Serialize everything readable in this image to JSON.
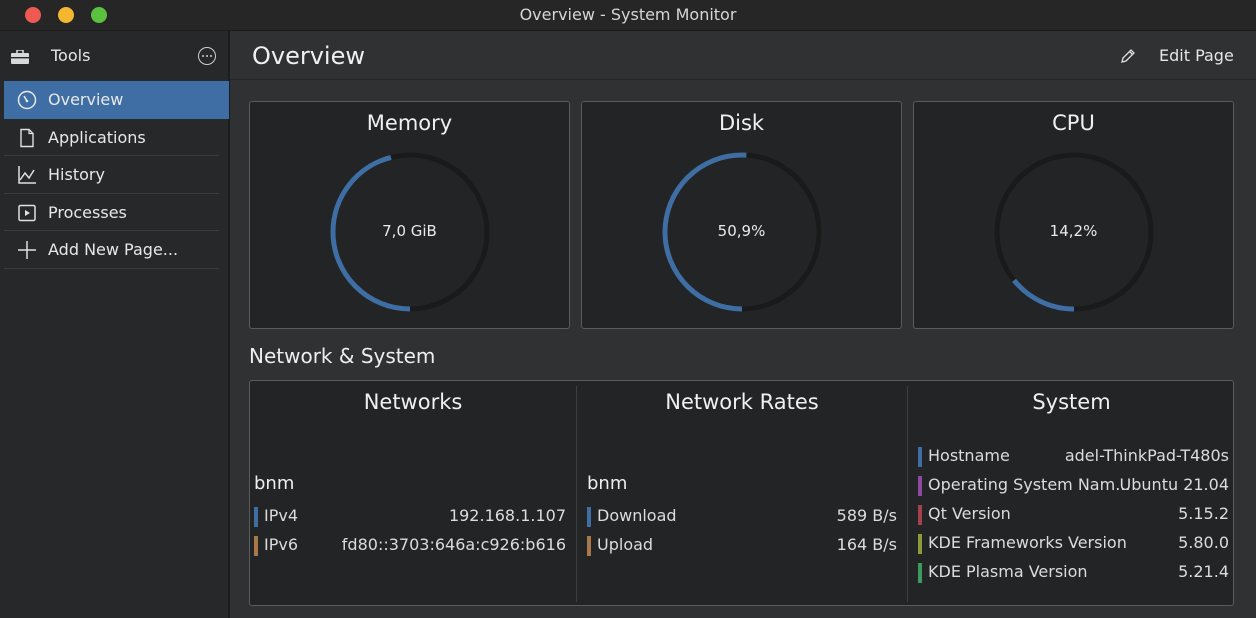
{
  "window": {
    "title": "Overview - System Monitor"
  },
  "sidebar": {
    "header_label": "Tools",
    "items": [
      {
        "label": "Overview",
        "icon": "speedometer-icon",
        "active": true
      },
      {
        "label": "Applications",
        "icon": "document-icon"
      },
      {
        "label": "History",
        "icon": "chart-line-icon"
      },
      {
        "label": "Processes",
        "icon": "play-window-icon"
      },
      {
        "label": "Add New Page...",
        "icon": "plus-icon"
      }
    ]
  },
  "header": {
    "title": "Overview",
    "edit_label": "Edit Page"
  },
  "gauges": [
    {
      "title": "Memory",
      "value": "7,0 GiB",
      "fraction": 0.46
    },
    {
      "title": "Disk",
      "value": "50,9%",
      "fraction": 0.509
    },
    {
      "title": "CPU",
      "value": "14,2%",
      "fraction": 0.142
    }
  ],
  "section_title": "Network & System",
  "networks": {
    "title": "Networks",
    "group": "bnm",
    "rows": [
      {
        "label": "IPv4",
        "value": "192.168.1.107",
        "color": "#3e6ea3"
      },
      {
        "label": "IPv6",
        "value": "fd80::3703:646a:c926:b616",
        "color": "#a9784a"
      }
    ]
  },
  "rates": {
    "title": "Network Rates",
    "group": "bnm",
    "rows": [
      {
        "label": "Download",
        "value": "589 B/s",
        "color": "#3e6ea3"
      },
      {
        "label": "Upload",
        "value": "164 B/s",
        "color": "#a9784a"
      }
    ]
  },
  "system": {
    "title": "System",
    "rows": [
      {
        "label": "Hostname",
        "value": "adel-ThinkPad-T480s",
        "color": "#3e6ea3"
      },
      {
        "label": "Operating System Nam...",
        "value": "Ubuntu 21.04",
        "color": "#8e4aa3"
      },
      {
        "label": "Qt Version",
        "value": "5.15.2",
        "color": "#a3424e"
      },
      {
        "label": "KDE Frameworks Version",
        "value": "5.80.0",
        "color": "#8f9a3a"
      },
      {
        "label": "KDE Plasma Version",
        "value": "5.21.4",
        "color": "#3d9a5c"
      }
    ]
  },
  "colors": {
    "accent": "#3e6ea3",
    "gauge_track": "#1a1a1b"
  }
}
